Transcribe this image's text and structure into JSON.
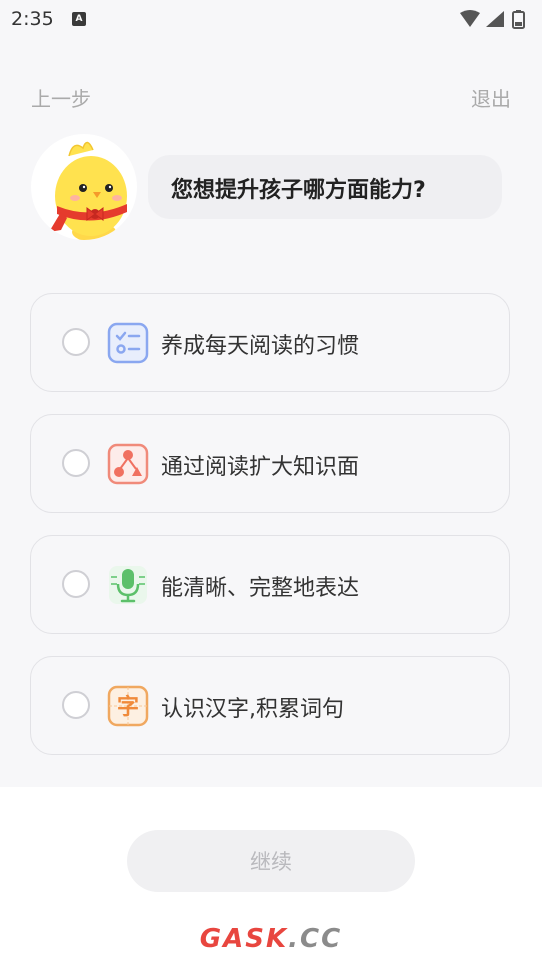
{
  "status": {
    "time": "2:35",
    "notification_letter": "A"
  },
  "nav": {
    "back_label": "上一步",
    "exit_label": "退出"
  },
  "question": "您想提升孩子哪方面能力?",
  "options": [
    {
      "label": "养成每天阅读的习惯",
      "icon": "checklist-icon",
      "color": "#8aa7f0"
    },
    {
      "label": "通过阅读扩大知识面",
      "icon": "knowledge-graph-icon",
      "color": "#f08a7a"
    },
    {
      "label": "能清晰、完整地表达",
      "icon": "microphone-icon",
      "color": "#5cc06a"
    },
    {
      "label": "认识汉字,积累词句",
      "icon": "chinese-character-icon",
      "color": "#f0a860"
    }
  ],
  "option_icon_text": {
    "character": "字"
  },
  "continue_label": "继续",
  "watermark": {
    "part1": "GASK",
    "part2": ".CC"
  },
  "colors": {
    "page_bg": "#f7f7f9",
    "card_border": "#e2e2e6",
    "button_bg": "#f0f0f2",
    "watermark_red": "#e8463f",
    "watermark_gray": "#8b8b8b"
  }
}
